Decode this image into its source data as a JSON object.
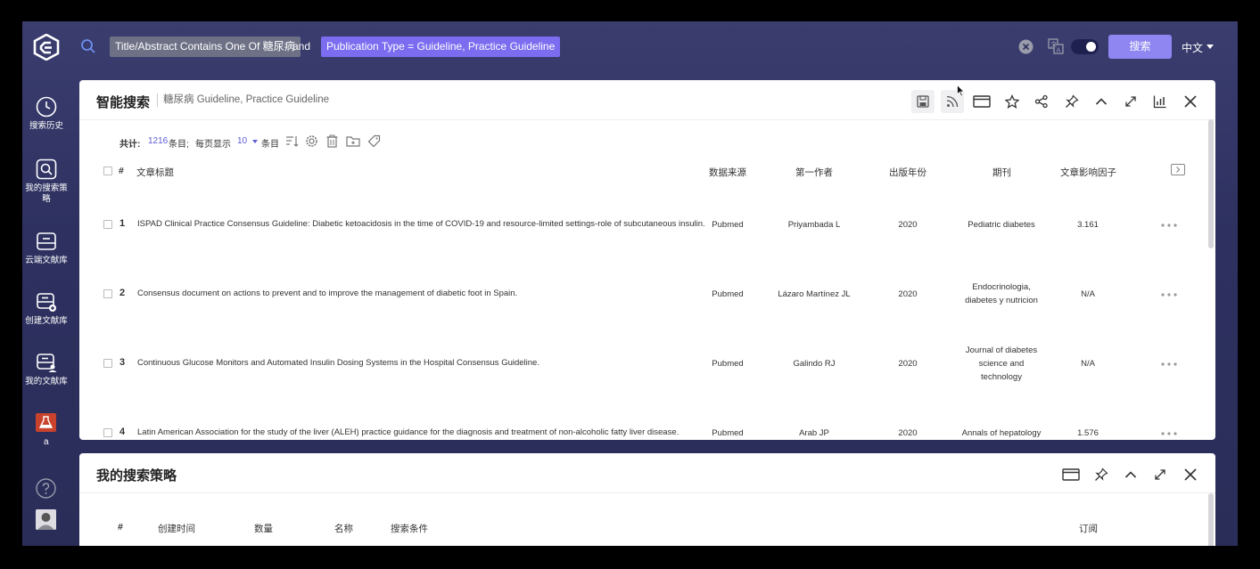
{
  "topbar": {
    "filter_title": "Title/Abstract Contains One Of 糖尿病",
    "connector": "and",
    "filter_type": "Publication Type = Guideline, Practice Guideline",
    "search_button": "搜索",
    "language": "中文"
  },
  "sidebar": {
    "items": [
      {
        "label": "搜索历史",
        "icon": "clock-icon"
      },
      {
        "label": "我的搜索策略",
        "icon": "search-strategy-icon"
      },
      {
        "label": "云端文献库",
        "icon": "cloud-library-icon"
      },
      {
        "label": "创建文献库",
        "icon": "create-library-icon"
      },
      {
        "label": "我的文献库",
        "icon": "my-library-icon"
      }
    ],
    "user_label": "a"
  },
  "search_panel": {
    "title": "智能搜索",
    "subtitle": "糖尿病 Guideline, Practice Guideline",
    "stats": {
      "total_label": "共计:",
      "total": "1216",
      "unit": "条目;",
      "per_page_label": "每页显示",
      "per_page": "10",
      "per_page_unit": "条目"
    },
    "columns": {
      "index": "#",
      "title": "文章标题",
      "source": "数据来源",
      "author": "第一作者",
      "year": "出版年份",
      "journal": "期刊",
      "impact": "文章影响因子"
    },
    "rows": [
      {
        "n": "1",
        "title": "ISPAD Clinical Practice Consensus Guideline: Diabetic ketoacidosis in the time of COVID-19 and resource-limited settings-role of subcutaneous insulin.",
        "source": "Pubmed",
        "author": "Priyambada L",
        "year": "2020",
        "journal": [
          "Pediatric diabetes"
        ],
        "impact": "3.161"
      },
      {
        "n": "2",
        "title": "Consensus document on actions to prevent and to improve the management of diabetic foot in Spain.",
        "source": "Pubmed",
        "author": "Lázaro Martínez JL",
        "year": "2020",
        "journal": [
          "Endocrinologia,",
          "diabetes y nutricion"
        ],
        "impact": "N/A"
      },
      {
        "n": "3",
        "title": "Continuous Glucose Monitors and Automated Insulin Dosing Systems in the Hospital Consensus Guideline.",
        "source": "Pubmed",
        "author": "Galindo RJ",
        "year": "2020",
        "journal": [
          "Journal of diabetes",
          "science and",
          "technology"
        ],
        "impact": "N/A"
      },
      {
        "n": "4",
        "title": "Latin American Association for the study of the liver (ALEH) practice guidance for the diagnosis and treatment of non-alcoholic fatty liver disease.",
        "source": "Pubmed",
        "author": "Arab JP",
        "year": "2020",
        "journal": [
          "Annals of hepatology"
        ],
        "impact": "1.576"
      }
    ]
  },
  "strategy_panel": {
    "title": "我的搜索策略",
    "columns": {
      "index": "#",
      "created": "创建时间",
      "count": "数量",
      "name": "名称",
      "criteria": "搜索条件",
      "subscribe": "订阅"
    }
  }
}
